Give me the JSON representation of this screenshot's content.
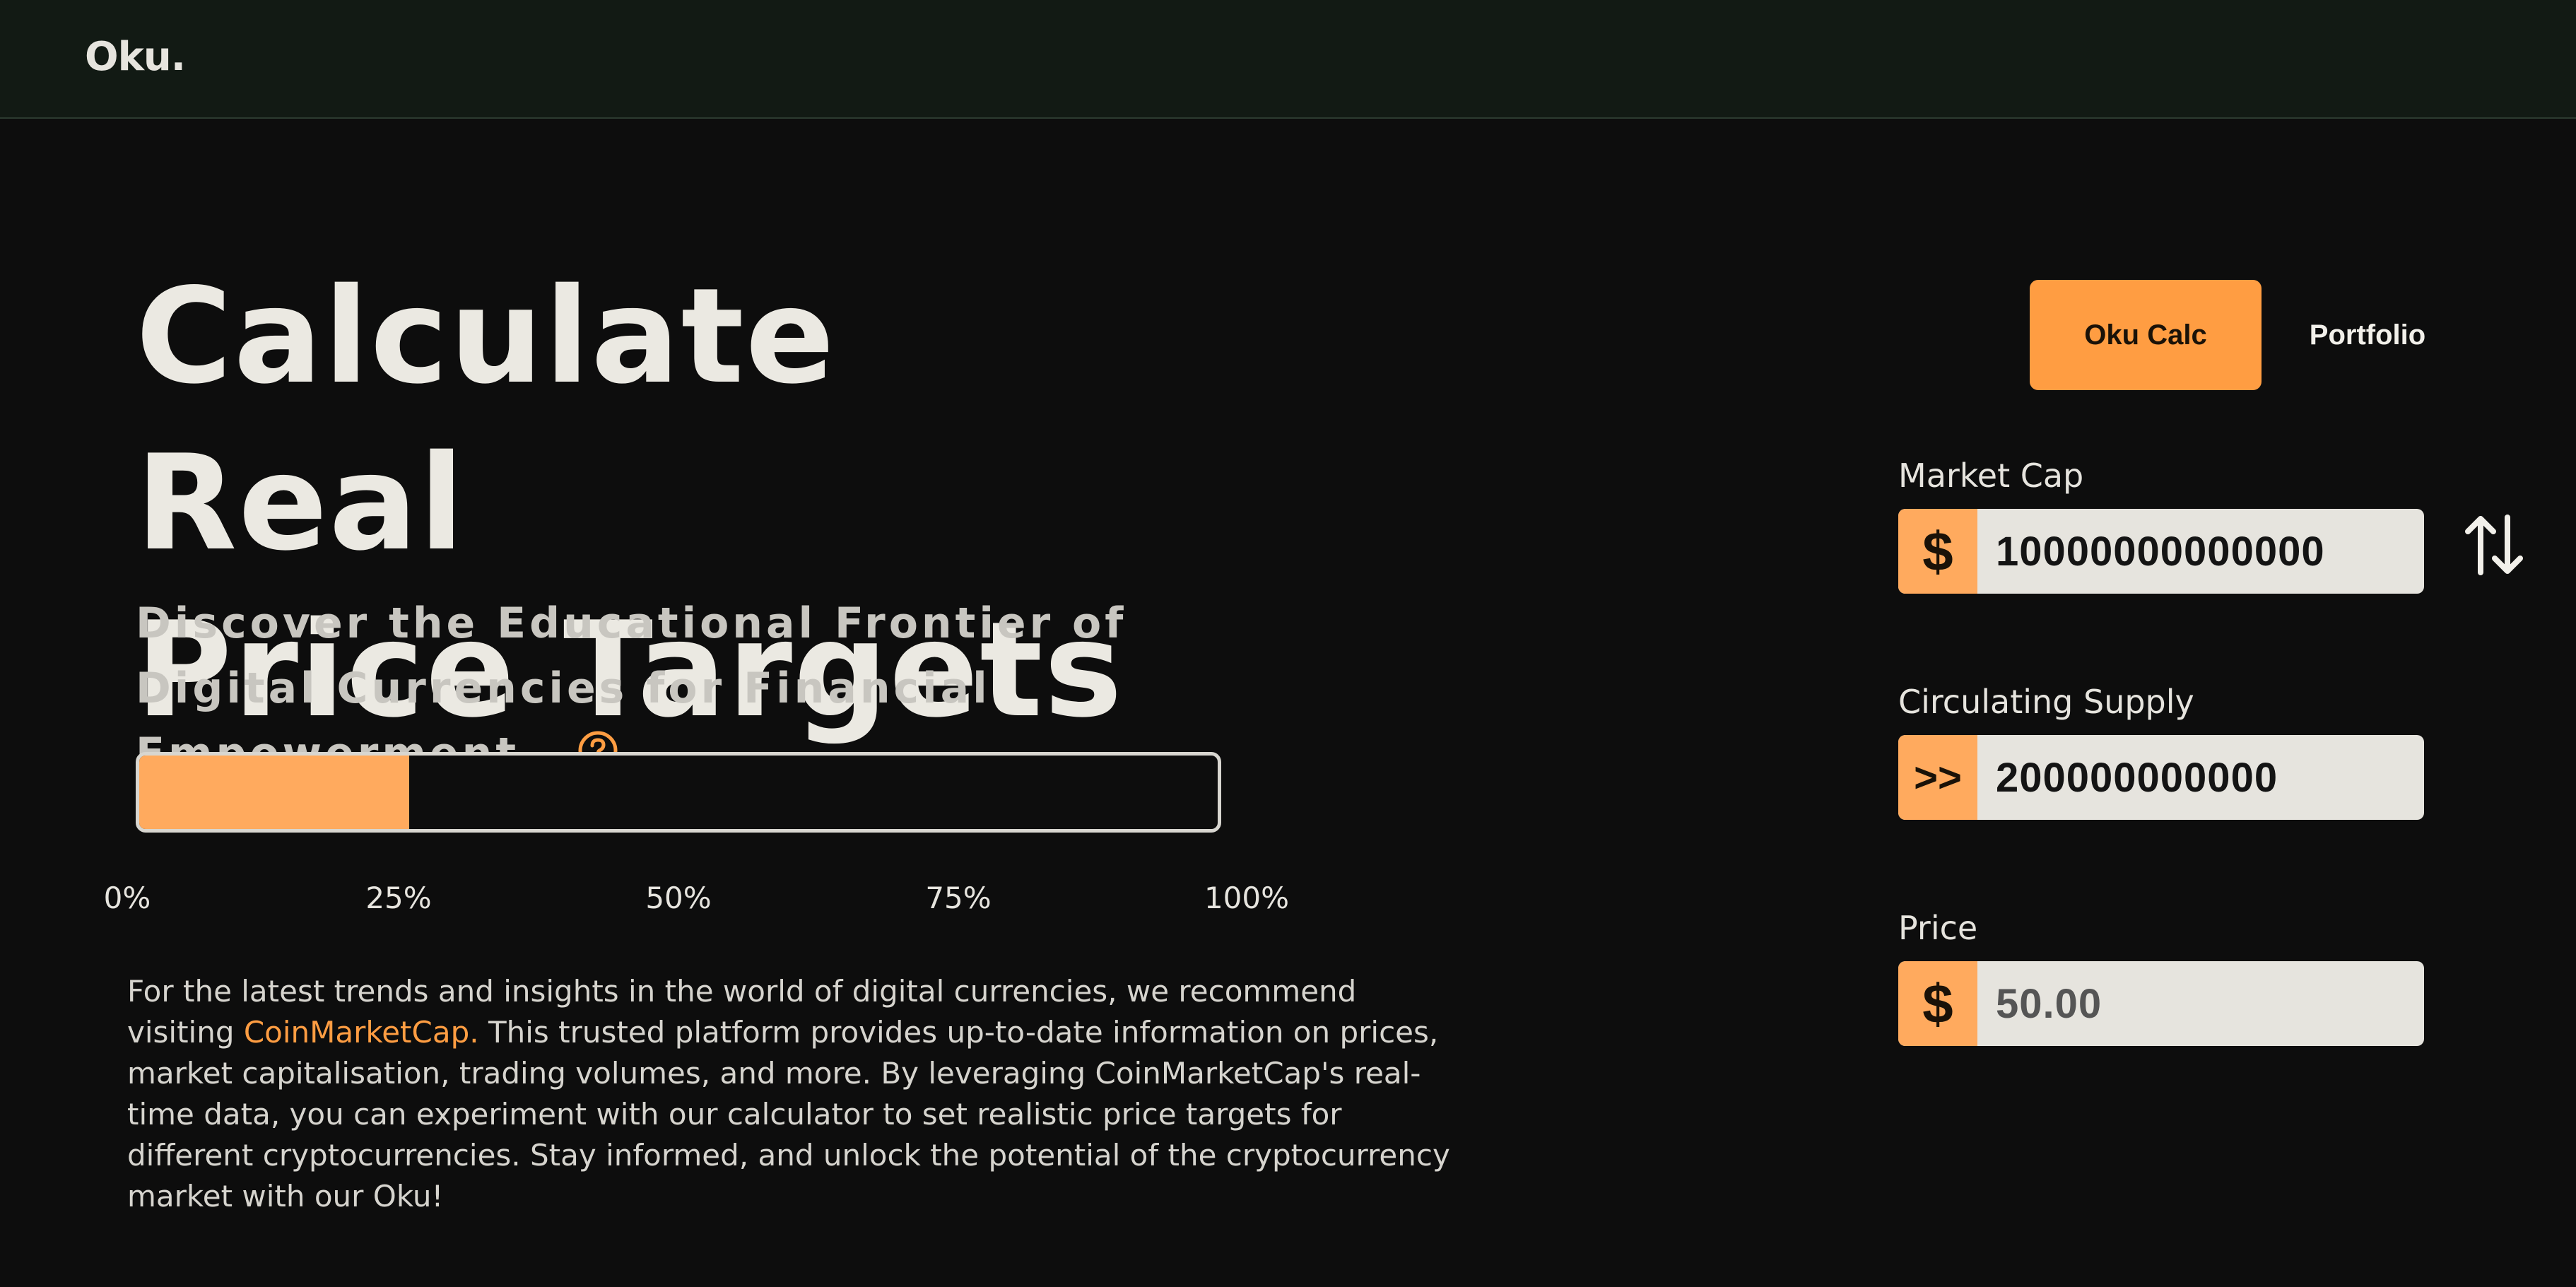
{
  "header": {
    "logo": "Oku."
  },
  "hero": {
    "title_line1": "Calculate Real",
    "title_line2": "Price Targets",
    "subtitle": "Discover the Educational Frontier of Digital Currencies for Financial Empowerment.",
    "help_icon": "question-circle-icon"
  },
  "progress": {
    "value_percent": 25,
    "ticks": [
      "0%",
      "25%",
      "50%",
      "75%",
      "100%"
    ]
  },
  "description": {
    "before_link": "For the latest trends and insights in the world of digital currencies, we recommend visiting ",
    "link_text": "CoinMarketCap.",
    "after_link": " This trusted platform provides up-to-date information on prices, market capitalisation, trading volumes, and more. By leveraging CoinMarketCap's real-time data, you can experiment with our calculator to set realistic price targets for different cryptocurrencies. Stay informed, and unlock the potential of the cryptocurrency market with our Oku!"
  },
  "tabs": {
    "calc": "Oku Calc",
    "portfolio": "Portfolio"
  },
  "fields": {
    "market_cap": {
      "label": "Market Cap",
      "prefix": "$",
      "value": "10000000000000"
    },
    "supply": {
      "label": "Circulating Supply",
      "prefix": ">>",
      "value": "200000000000"
    },
    "price": {
      "label": "Price",
      "prefix": "$",
      "value": "50.00"
    }
  },
  "icons": {
    "swap": "swap-vertical-arrows-icon"
  },
  "colors": {
    "accent": "#ff9d42",
    "accent_light": "#ffaa5e",
    "background": "#0d0d0d",
    "header_bg": "#121a14"
  }
}
